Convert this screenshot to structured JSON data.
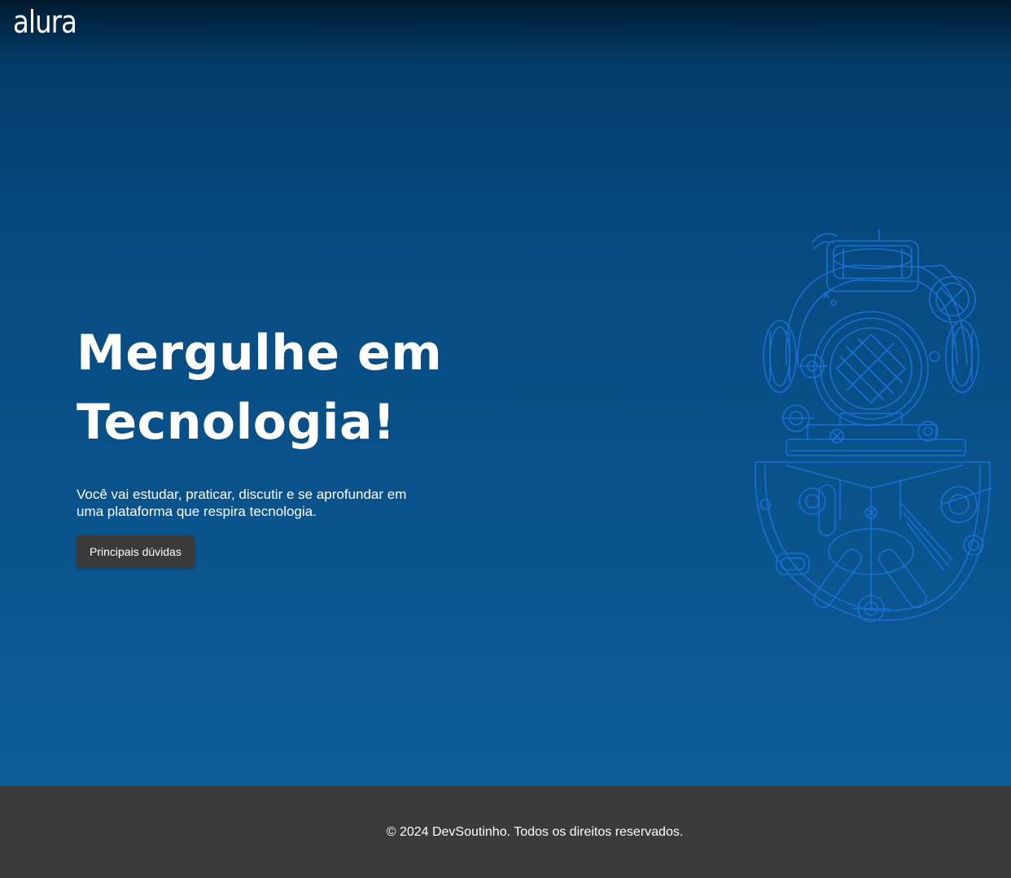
{
  "header": {
    "logo_text": "alura"
  },
  "hero": {
    "headline_line1": "Mergulhe em",
    "headline_line2": "Tecnologia!",
    "subtitle": "Você vai estudar, praticar, discutir e se aprofundar em uma plataforma que respira tecnologia.",
    "cta_label": "Principais dúvidas",
    "illustration_icon": "diving-helmet-icon"
  },
  "footer": {
    "copyright": "© 2024 DevSoutinho. Todos os direitos reservados."
  },
  "colors": {
    "hero_top": "#001a2f",
    "hero_bottom": "#0d5c98",
    "illustration_stroke": "#1a6fd1",
    "button_bg": "#3a3a3a",
    "footer_bg": "#3b3b3b",
    "text": "#ffffff"
  }
}
